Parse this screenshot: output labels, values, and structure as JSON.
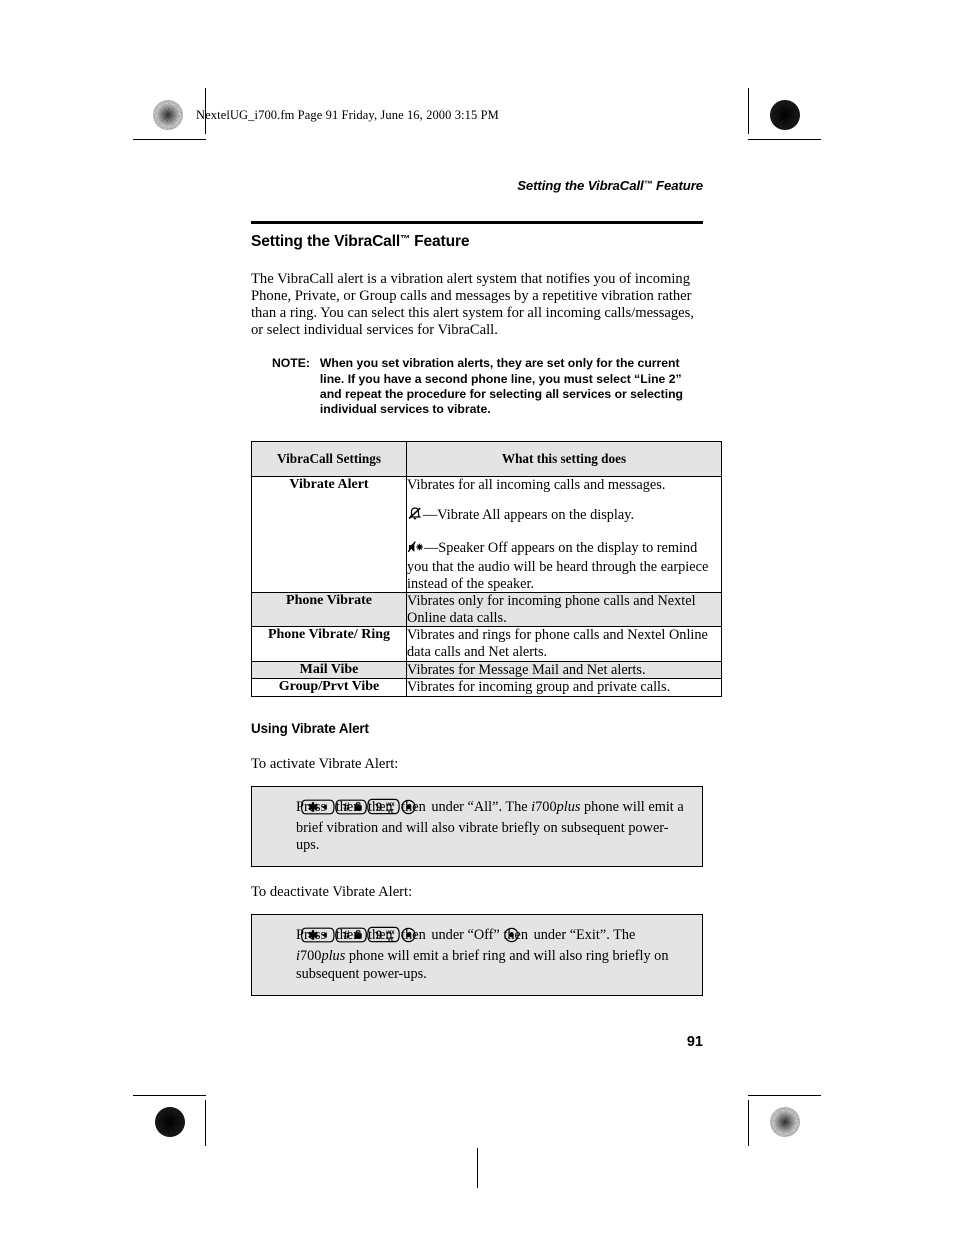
{
  "print_info": {
    "file_line": "NextelUG_i700.fm  Page 91  Friday, June 16, 2000  3:15 PM"
  },
  "running_header": {
    "text_before_tm": "Setting the VibraCall",
    "tm": "™",
    "text_after_tm": " Feature"
  },
  "section": {
    "title_before_tm": "Setting the VibraCall",
    "title_tm": "™",
    "title_after_tm": " Feature",
    "intro": "The VibraCall alert is a vibration alert system that notifies you of incoming Phone, Private, or Group calls and messages by a repetitive vibration rather than a ring. You can select this alert system for all incoming calls/messages, or select individual services for VibraCall."
  },
  "note": {
    "label": "NOTE:",
    "text": "When you set vibration alerts, they are set only for the current line. If you have a second phone line, you must select “Line 2” and repeat the procedure for selecting all services or selecting individual services to vibrate."
  },
  "table": {
    "headers": [
      "VibraCall Settings",
      "What this setting does"
    ],
    "rows": [
      {
        "setting": "Vibrate Alert",
        "shaded": false,
        "paragraphs": [
          {
            "icon": null,
            "text": "Vibrates for all incoming calls and messages."
          },
          {
            "icon": "bell-slash-icon",
            "text": "—Vibrate All appears on the display."
          },
          {
            "icon": "speaker-off-icon",
            "text": "—Speaker Off appears on the display to remind you that the audio will be heard through the earpiece instead of the speaker."
          }
        ]
      },
      {
        "setting": "Phone Vibrate",
        "shaded": true,
        "paragraphs": [
          {
            "icon": null,
            "text": "Vibrates only for incoming phone calls and Nextel Online data calls."
          }
        ]
      },
      {
        "setting": "Phone Vibrate/ Ring",
        "shaded": false,
        "paragraphs": [
          {
            "icon": null,
            "text": "Vibrates and rings for phone calls and Nextel Online data calls and Net alerts."
          }
        ]
      },
      {
        "setting": "Mail Vibe",
        "shaded": true,
        "paragraphs": [
          {
            "icon": null,
            "text": "Vibrates for Message Mail and Net alerts."
          }
        ]
      },
      {
        "setting": "Group/Prvt Vibe",
        "shaded": false,
        "paragraphs": [
          {
            "icon": null,
            "text": "Vibrates for incoming group and private calls."
          }
        ]
      }
    ]
  },
  "subsection": {
    "title": "Using Vibrate Alert",
    "activate_lead": "To activate Vibrate Alert:",
    "deactivate_lead": "To deactivate Vibrate Alert:"
  },
  "procedures": {
    "activate": {
      "press_word": "Press",
      "then_1": "then",
      "then_2": "then",
      "then_3": "then",
      "under_phrase": "under “All”. The",
      "model_i": "i",
      "model_num": "700",
      "model_plus": "plus",
      "tail": " phone will emit a brief vibration and will also vibrate briefly on subsequent power-ups."
    },
    "deactivate": {
      "press_word": "Press",
      "then_1": "then",
      "then_2": "then",
      "then_3": "then",
      "under_phrase_1": "under “Off” then",
      "under_phrase_2": "under “Exit”. The ",
      "model_i": "i",
      "model_num": "700",
      "model_plus": "plus",
      "tail": " phone will emit a brief ring and will also ring briefly on subsequent power-ups."
    }
  },
  "keys": {
    "star": {
      "name": "star-key",
      "glyph": "✱",
      "sub": "◄"
    },
    "pound": {
      "name": "pound-key",
      "glyph": "#",
      "sub": "lock"
    },
    "nine": {
      "name": "nine-key",
      "glyph": "9",
      "sub_top": "wx",
      "sub_bottom": "yz"
    },
    "option": {
      "name": "option-select-key",
      "glyph": "●"
    }
  },
  "page_number": "91",
  "colors": {
    "shading": "#e4e4e4",
    "rule": "#000000",
    "text": "#000000"
  }
}
